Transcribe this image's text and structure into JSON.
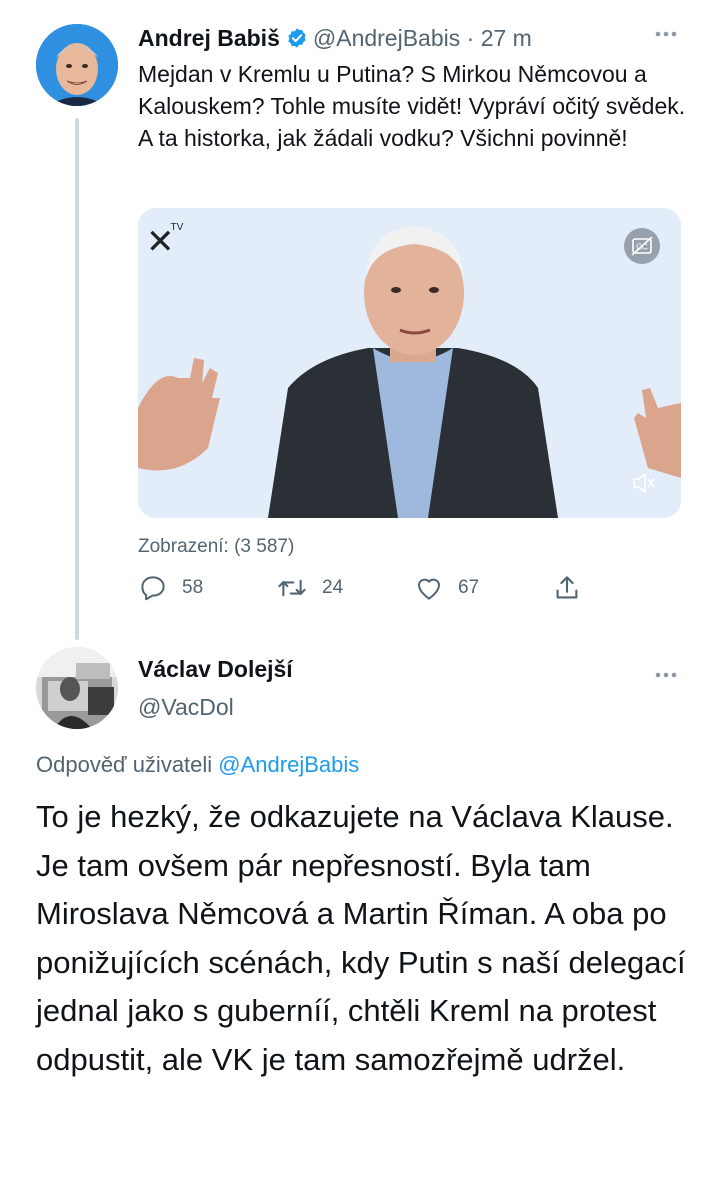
{
  "tweet1": {
    "author_name": "Andrej Babiš",
    "handle": "@AndrejBabis",
    "time_sep": " · ",
    "time": "27 m",
    "text": "Mejdan v Kremlu u Putina? S Mirkou Němcovou a Kalouskem? Tohle musíte vidět! Vypráví očitý svědek. A ta historka, jak žádali vodku? Všichni povinně!",
    "media_logo": "TV",
    "views_text": "Zobrazení: (3 587)",
    "actions": {
      "replies": "58",
      "retweets": "24",
      "likes": "67"
    },
    "verified": true
  },
  "tweet2": {
    "author_name": "Václav Dolejší",
    "handle": "@VacDol",
    "reply_prefix": "Odpověď uživateli ",
    "reply_handle": "@AndrejBabis",
    "text": "To je hezký, že odkazujete na Václava Klause. Je tam ovšem pár nepřesností. Byla tam Miroslava Němcová a Martin Říman. A oba po ponižujících scénách, kdy Putin s naší delegací jednal jako s guberníí, chtěli Kreml na protest odpustit, ale VK je tam samozřejmě udržel."
  },
  "icons": {
    "verified": "verified-badge-icon",
    "more": "more-horizontal-icon",
    "cc": "closed-captions-icon",
    "mute": "mute-icon",
    "reply": "reply-icon",
    "retweet": "retweet-icon",
    "like": "like-icon",
    "share": "share-icon"
  },
  "colors": {
    "accent": "#1d9bf0",
    "muted": "#536471",
    "text": "#0f1419"
  }
}
